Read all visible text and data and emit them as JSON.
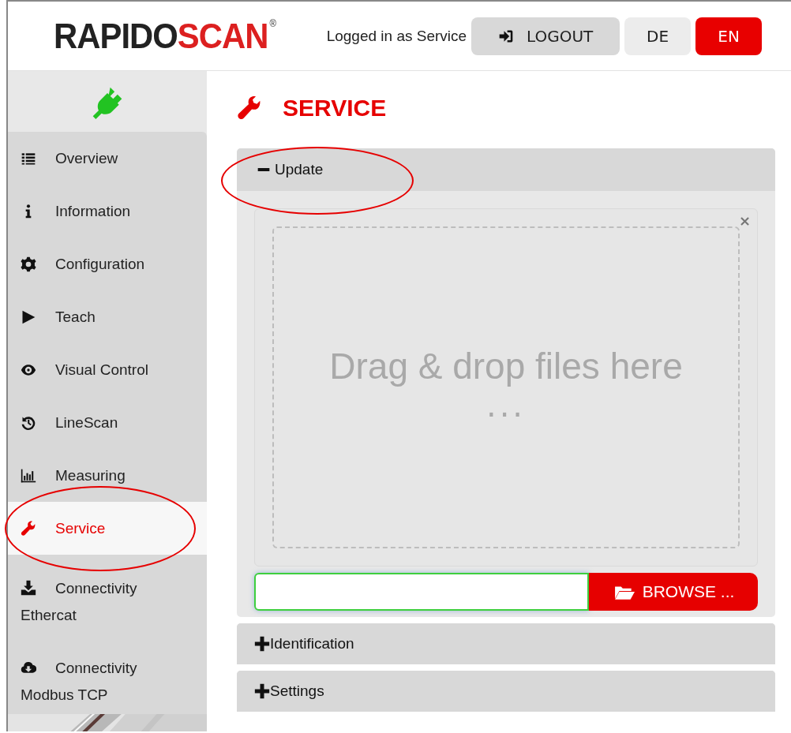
{
  "header": {
    "logo": {
      "part_1": "RAPIDO",
      "part_2": "SCAN",
      "mark": "®"
    },
    "user_text": "Logged in as Service",
    "logout_button": "LOGOUT",
    "languages": [
      {
        "label": "DE",
        "selected": false
      },
      {
        "label": "EN",
        "selected": true
      }
    ]
  },
  "sidebar": {
    "items": [
      {
        "label": "Overview",
        "selected": false,
        "circled": false
      },
      {
        "label": "Information",
        "selected": false,
        "circled": false
      },
      {
        "label": "Configuration",
        "selected": false,
        "circled": false
      },
      {
        "label": "Teach",
        "selected": false,
        "circled": false
      },
      {
        "label": "Visual Control",
        "selected": false,
        "circled": false
      },
      {
        "label": "LineScan",
        "selected": false,
        "circled": false
      },
      {
        "label": "Measuring",
        "selected": false,
        "circled": false
      },
      {
        "label": "Service",
        "selected": true,
        "circled": true
      },
      {
        "label": "Connectivity Ethercat",
        "selected": false,
        "circled": false
      },
      {
        "label": "Connectivity Modbus TCP",
        "selected": false,
        "circled": false
      }
    ]
  },
  "page_title": "SERVICE",
  "panels": [
    {
      "title": "Update",
      "expanded": true,
      "circled": true,
      "dropzone": {
        "text": "Drag & drop files here",
        "ellipsis": "...",
        "close": "×"
      },
      "browse_button": "BROWSE ..."
    },
    {
      "title": "Identification",
      "expanded": false,
      "circled": false
    },
    {
      "title": "Settings",
      "expanded": false,
      "circled": false
    }
  ]
}
